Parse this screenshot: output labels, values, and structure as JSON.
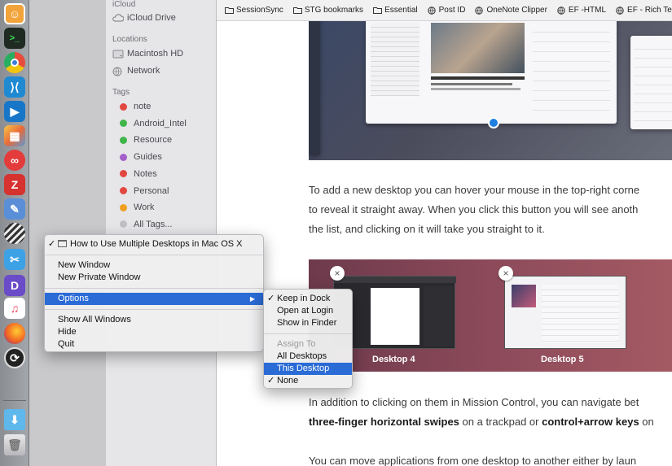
{
  "finder": {
    "icloud_header": "iCloud",
    "icloud_drive": "iCloud Drive",
    "locations_header": "Locations",
    "locations": [
      "Macintosh HD",
      "Network"
    ],
    "tags_header": "Tags",
    "tags": [
      {
        "label": "note",
        "color": "#e2473f"
      },
      {
        "label": "Android_Intel",
        "color": "#3fb54a"
      },
      {
        "label": "Resource",
        "color": "#3fb54a"
      },
      {
        "label": "Guides",
        "color": "#a55fc8"
      },
      {
        "label": "Notes",
        "color": "#e2473f"
      },
      {
        "label": "Personal",
        "color": "#e2473f"
      },
      {
        "label": "Work",
        "color": "#f0a020"
      },
      {
        "label": "All Tags...",
        "color": "#c0c0c4"
      }
    ]
  },
  "bookmarks": [
    {
      "label": "SessionSync",
      "icon": "folder-icon"
    },
    {
      "label": "STG bookmarks",
      "icon": "folder-icon"
    },
    {
      "label": "Essential",
      "icon": "folder-icon"
    },
    {
      "label": "Post ID",
      "icon": "globe-icon"
    },
    {
      "label": "OneNote Clipper",
      "icon": "globe-icon"
    },
    {
      "label": "EF -HTML",
      "icon": "globe-icon"
    },
    {
      "label": "EF - Rich Text",
      "icon": "globe-icon"
    }
  ],
  "article": {
    "p1": [
      "To add a new desktop you can hover your mouse in the top-right corne",
      "to reveal it straight away. When you click this button you will see anoth",
      "the list, and clicking on it will take you straight to it."
    ],
    "desktop4": "Desktop 4",
    "desktop5": "Desktop 5",
    "p2_line1": "In addition to clicking on them in Mission Control, you can navigate bet",
    "p2_bold1": "three-finger horizontal swipes",
    "p2_mid": " on a trackpad or ",
    "p2_bold2": "control+arrow keys",
    "p2_tail": " on",
    "p3": "You can move applications from one desktop to another either by laun"
  },
  "dock_menu": {
    "window_title": "How to Use Multiple Desktops in Mac OS X",
    "new_window": "New Window",
    "new_private_window": "New Private Window",
    "options": "Options",
    "show_all_windows": "Show All Windows",
    "hide": "Hide",
    "quit": "Quit"
  },
  "options_menu": {
    "keep_in_dock": "Keep in Dock",
    "open_at_login": "Open at Login",
    "show_in_finder": "Show in Finder",
    "assign_to": "Assign To",
    "all_desktops": "All Desktops",
    "this_desktop": "This Desktop",
    "none": "None"
  },
  "colors": {
    "accent": "#2a6bd6"
  }
}
